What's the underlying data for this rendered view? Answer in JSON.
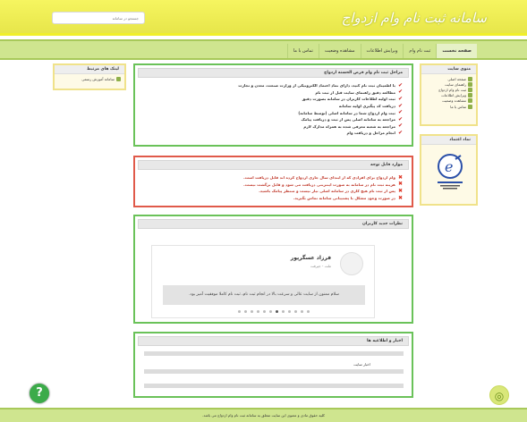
{
  "header": {
    "logo": "سامانه ثبت نام وام ازدواج",
    "search_placeholder": "جستجو در سامانه"
  },
  "nav": {
    "items": [
      "صفحه نخست",
      "ثبت نام وام",
      "ویرایش اطلاعات",
      "مشاهده وضعیت",
      "تماس با ما"
    ]
  },
  "right_sidebar": {
    "menu_title": "منوی سایت",
    "menu_items": [
      "صفحه اصلی",
      "راهنمای سایت",
      "ثبت نام وام ازدواج",
      "ویرایش اطلاعات",
      "مشاهده وضعیت",
      "تماس با ما"
    ],
    "trust_title": "نماد اعتماد"
  },
  "left_sidebar": {
    "title": "لینک های مرتبط",
    "items": [
      "سامانه آموزش رسمی"
    ]
  },
  "steps_box": {
    "title": "مراحل ثبت نام وام قرض الحسنه ازدواج",
    "items": [
      "با اطمینان ثبت نام کنید، دارای نماد اعتماد الکترونیکی از وزارت صنعت، معدن و تجارت",
      "مطالعه دقیق راهنمای سایت قبل از ثبت نام",
      "ثبت اولیه اطلاعات کاربران در سامانه بصورت دقیق",
      "دریافت کد پیگیری اولیه سامانه",
      "ثبت وام ازدواج شما در سامانه اصلی (توسط سامانه)",
      "مراجعه به سامانه اصلی پس از ثبت و دریافت پیامک",
      "مراجعه به شعبه معرفی شده به همراه مدارک لازم",
      "انجام مراحل و دریافت وام"
    ]
  },
  "warnings_box": {
    "title": "موارد قابل توجه",
    "items": [
      "وام ازدواج برای افرادی که از ابتدای سال جاری ازدواج کرده اند قابل دریافت است.",
      "هزینه ثبت نام در سامانه به صورت اینترنتی دریافت می شود و قابل برگشت نیست.",
      "پس از ثبت نام هیچ کاری در سامانه اصلی نیاز نیست و منتظر پیامک باشید.",
      "در صورت وجود مشکل با پشتیبانی سامانه تماس بگیرید."
    ]
  },
  "testimonials_box": {
    "title": "نظرات جدید کاربران",
    "name": "فرزاد عسگرپور",
    "role": "ملت - جیرفت",
    "text": "سلام ممنون از سایت عالی و سرعت بالا در انجام ثبت نام، ثبت نام کاملا موفقیت آمیز بود.",
    "dot_count": 12,
    "active_dot": 6
  },
  "news_box": {
    "title": "اخبار و اطلاعیه ها",
    "label": "اخبار سایت"
  },
  "footer": {
    "text": "کلیه حقوق مادی و معنوی این سایت متعلق به سامانه ثبت نام وام ازدواج می باشد."
  },
  "colors": {
    "header": "#f6f560",
    "nav": "#cfe58f",
    "green_border": "#6ac259",
    "red_border": "#e05a4a",
    "float_left": "#3cab4a"
  }
}
